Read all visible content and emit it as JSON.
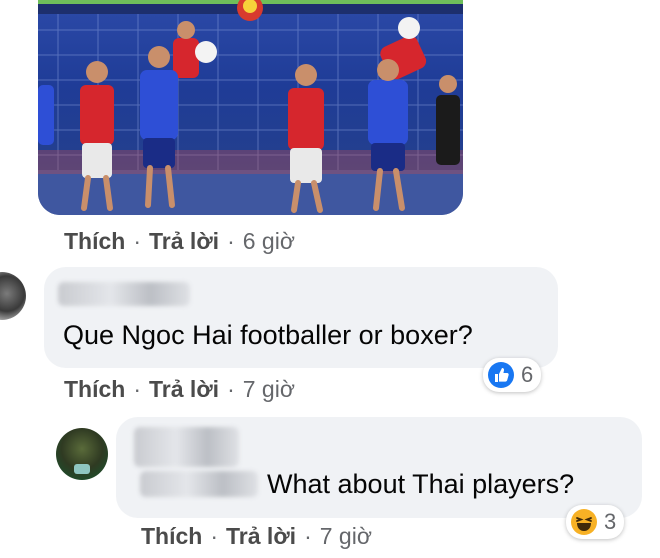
{
  "colors": {
    "bubble_bg": "#f0f2f5",
    "action_text": "#4b4b4b",
    "meta_text": "#65676b",
    "like_blue": "#1877f2",
    "haha_yellow": "#f7b125"
  },
  "post_image": {
    "description_icon": "football-match-photo-icon"
  },
  "comments": [
    {
      "actions": {
        "like": "Thích",
        "reply": "Trả lời",
        "time": "6 giờ"
      }
    },
    {
      "text": "Que Ngoc Hai footballer or boxer?",
      "actions": {
        "like": "Thích",
        "reply": "Trả lời",
        "time": "7 giờ"
      },
      "reaction": {
        "icon": "like-icon",
        "count": "6"
      }
    },
    {
      "text": "What about Thai players?",
      "actions": {
        "like": "Thích",
        "reply": "Trả lời",
        "time": "7 giờ"
      },
      "reaction": {
        "icon": "haha-icon",
        "count": "3"
      }
    }
  ]
}
